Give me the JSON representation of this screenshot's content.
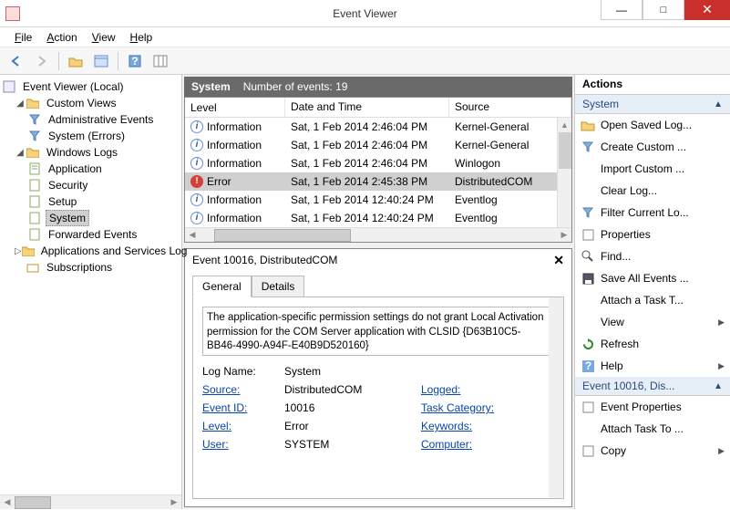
{
  "window": {
    "title": "Event Viewer"
  },
  "menu": {
    "file": "File",
    "action": "Action",
    "view": "View",
    "help": "Help"
  },
  "tree": {
    "root": "Event Viewer (Local)",
    "custom_views": "Custom Views",
    "admin_events": "Administrative Events",
    "system_errors": "System (Errors)",
    "windows_logs": "Windows Logs",
    "application": "Application",
    "security": "Security",
    "setup": "Setup",
    "system": "System",
    "forwarded": "Forwarded Events",
    "apps_svcs": "Applications and Services Log",
    "subscriptions": "Subscriptions"
  },
  "grid": {
    "title": "System",
    "count_label": "Number of events: 19",
    "cols": {
      "level": "Level",
      "date": "Date and Time",
      "source": "Source"
    },
    "rows": [
      {
        "level": "Information",
        "icon": "info",
        "date": "Sat, 1 Feb 2014 2:46:04 PM",
        "source": "Kernel-General"
      },
      {
        "level": "Information",
        "icon": "info",
        "date": "Sat, 1 Feb 2014 2:46:04 PM",
        "source": "Kernel-General"
      },
      {
        "level": "Information",
        "icon": "info",
        "date": "Sat, 1 Feb 2014 2:46:04 PM",
        "source": "Winlogon"
      },
      {
        "level": "Error",
        "icon": "error",
        "date": "Sat, 1 Feb 2014 2:45:38 PM",
        "source": "DistributedCOM"
      },
      {
        "level": "Information",
        "icon": "info",
        "date": "Sat, 1 Feb 2014 12:40:24 PM",
        "source": "Eventlog"
      },
      {
        "level": "Information",
        "icon": "info",
        "date": "Sat, 1 Feb 2014 12:40:24 PM",
        "source": "Eventlog"
      }
    ]
  },
  "detail": {
    "title": "Event 10016, DistributedCOM",
    "tab_general": "General",
    "tab_details": "Details",
    "message": "The application-specific permission settings do not grant Local Activation permission for the COM Server application with CLSID\n{D63B10C5-BB46-4990-A94F-E40B9D520160}",
    "labels": {
      "log_name": "Log Name:",
      "source": "Source:",
      "event_id": "Event ID:",
      "level": "Level:",
      "user": "User:",
      "logged": "Logged:",
      "task": "Task Category:",
      "keywords": "Keywords:",
      "computer": "Computer:"
    },
    "values": {
      "log_name": "System",
      "source": "DistributedCOM",
      "event_id": "10016",
      "level": "Error",
      "user": "SYSTEM"
    }
  },
  "actions": {
    "title": "Actions",
    "section1": "System",
    "items1": [
      "Open Saved Log...",
      "Create Custom ...",
      "Import Custom ...",
      "Clear Log...",
      "Filter Current Lo...",
      "Properties",
      "Find...",
      "Save All Events ...",
      "Attach a Task T...",
      "View",
      "Refresh",
      "Help"
    ],
    "section2": "Event 10016, Dis...",
    "items2": [
      "Event Properties",
      "Attach Task To ...",
      "Copy"
    ]
  }
}
